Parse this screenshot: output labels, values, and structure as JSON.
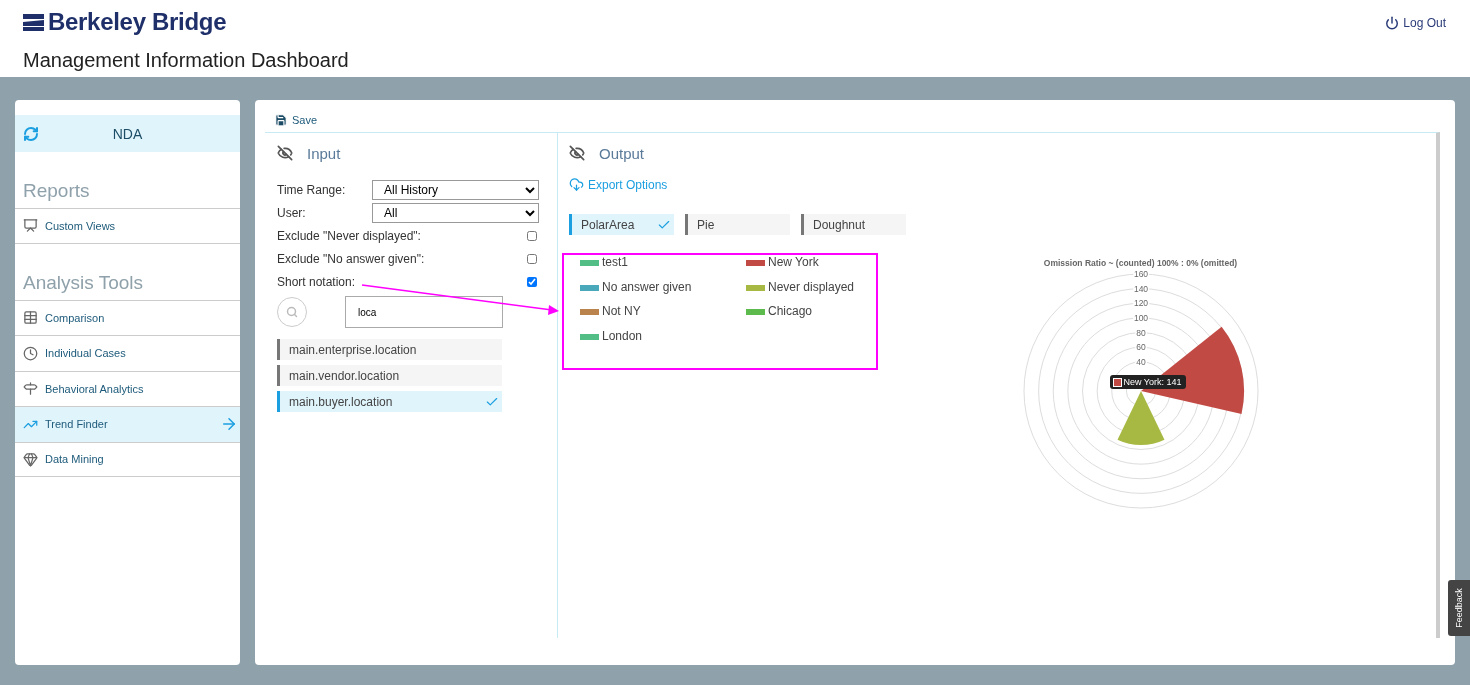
{
  "header": {
    "logo": "Berkeley Bridge",
    "logout": "Log Out",
    "title": "Management Information Dashboard"
  },
  "sidebar": {
    "top_item": "NDA",
    "sections": [
      {
        "heading": "Reports",
        "items": [
          {
            "label": "Custom Views",
            "selected": false
          }
        ]
      },
      {
        "heading": "Analysis Tools",
        "items": [
          {
            "label": "Comparison",
            "selected": false
          },
          {
            "label": "Individual Cases",
            "selected": false
          },
          {
            "label": "Behavioral Analytics",
            "selected": false
          },
          {
            "label": "Trend Finder",
            "selected": true
          },
          {
            "label": "Data Mining",
            "selected": false
          }
        ]
      }
    ]
  },
  "toolbar": {
    "save": "Save"
  },
  "input": {
    "title": "Input",
    "fields": [
      {
        "kind": "select",
        "label": "Time Range:",
        "value": "All History"
      },
      {
        "kind": "select",
        "label": "User:",
        "value": "All"
      },
      {
        "kind": "checkbox",
        "label": "Exclude \"Never displayed\":",
        "checked": false
      },
      {
        "kind": "checkbox",
        "label": "Exclude \"No answer given\":",
        "checked": false
      },
      {
        "kind": "checkbox",
        "label": "Short notation:",
        "checked": true
      }
    ],
    "search": {
      "value": "loca"
    },
    "options": [
      {
        "label": "main.enterprise.location",
        "selected": false
      },
      {
        "label": "main.vendor.location",
        "selected": false
      },
      {
        "label": "main.buyer.location",
        "selected": true
      }
    ]
  },
  "output": {
    "title": "Output",
    "export": "Export Options",
    "chart_types": [
      {
        "label": "PolarArea",
        "selected": true
      },
      {
        "label": "Pie",
        "selected": false
      },
      {
        "label": "Doughnut",
        "selected": false
      }
    ],
    "legend": [
      {
        "label": "test1",
        "color": "#52bd84"
      },
      {
        "label": "New York",
        "color": "#c24a45"
      },
      {
        "label": "No answer given",
        "color": "#4aa8bb"
      },
      {
        "label": "Never displayed",
        "color": "#a8b943"
      },
      {
        "label": "Not NY",
        "color": "#b9834b"
      },
      {
        "label": "Chicago",
        "color": "#5cbb4c"
      },
      {
        "label": "London",
        "color": "#52bd84"
      }
    ],
    "chart": {
      "title": "Omission Ratio ~ (counted) 100% : 0% (omitted)",
      "ticks": [
        "160",
        "140",
        "120",
        "100",
        "80",
        "60",
        "40"
      ],
      "tooltip": "New York: 141"
    }
  },
  "feedback": "Feedback"
}
